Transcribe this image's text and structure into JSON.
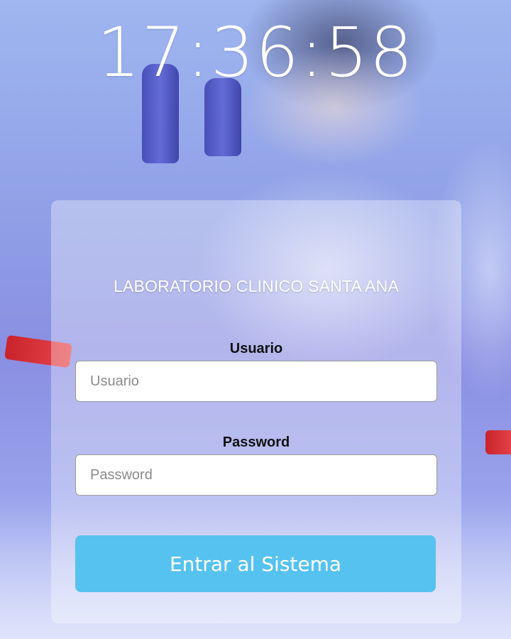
{
  "clock": {
    "time": "17:36:58"
  },
  "login": {
    "title": "LABORATORIO CLINICO SANTA ANA",
    "username_label": "Usuario",
    "username_placeholder": "Usuario",
    "username_value": "",
    "password_label": "Password",
    "password_placeholder": "Password",
    "password_value": "",
    "submit_label": "Entrar al Sistema"
  },
  "colors": {
    "button": "#56c2ef",
    "panel_overlay": "rgba(255,255,255,0.34)",
    "text_light": "#ffffff",
    "label_text": "#111111"
  }
}
